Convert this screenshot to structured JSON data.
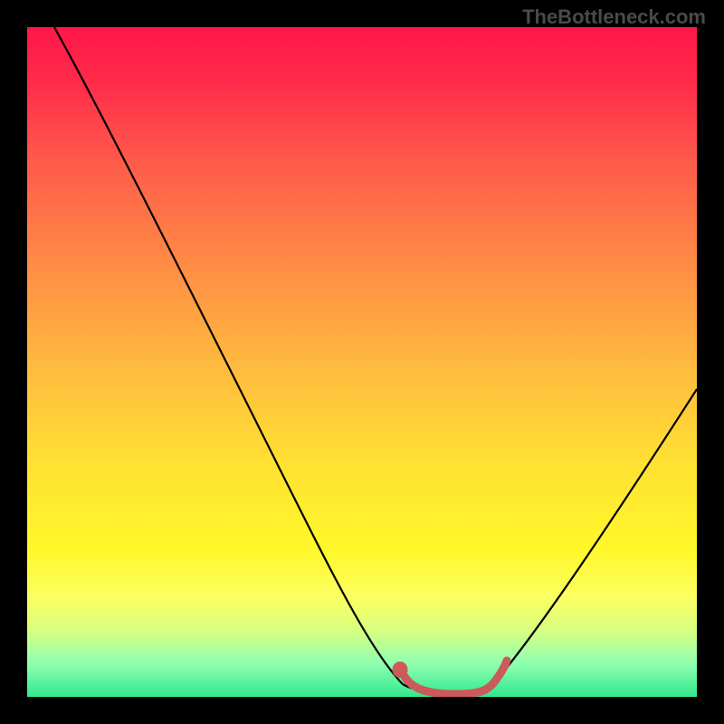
{
  "watermark": "TheBottleneck.com",
  "chart_data": {
    "type": "line",
    "title": "",
    "xlabel": "",
    "ylabel": "",
    "xlim": [
      0,
      100
    ],
    "ylim": [
      0,
      100
    ],
    "series": [
      {
        "name": "main-curve",
        "color": "#000000",
        "x": [
          0,
          10,
          20,
          30,
          40,
          50,
          54,
          58,
          62,
          66,
          70,
          80,
          90,
          100
        ],
        "y": [
          100,
          84,
          68,
          52,
          36,
          20,
          9,
          2,
          0,
          0,
          2,
          12,
          28,
          46
        ]
      },
      {
        "name": "highlight-segment",
        "color": "#cc5a5a",
        "x": [
          56,
          58,
          60,
          62,
          64,
          66,
          68,
          70
        ],
        "y": [
          5,
          2,
          0,
          0,
          0,
          0,
          1,
          3
        ]
      }
    ],
    "background_gradient": {
      "top": "#ff1648",
      "mid_upper": "#ff8a45",
      "mid": "#ffe033",
      "mid_lower": "#fcff60",
      "bottom": "#30e890"
    }
  }
}
